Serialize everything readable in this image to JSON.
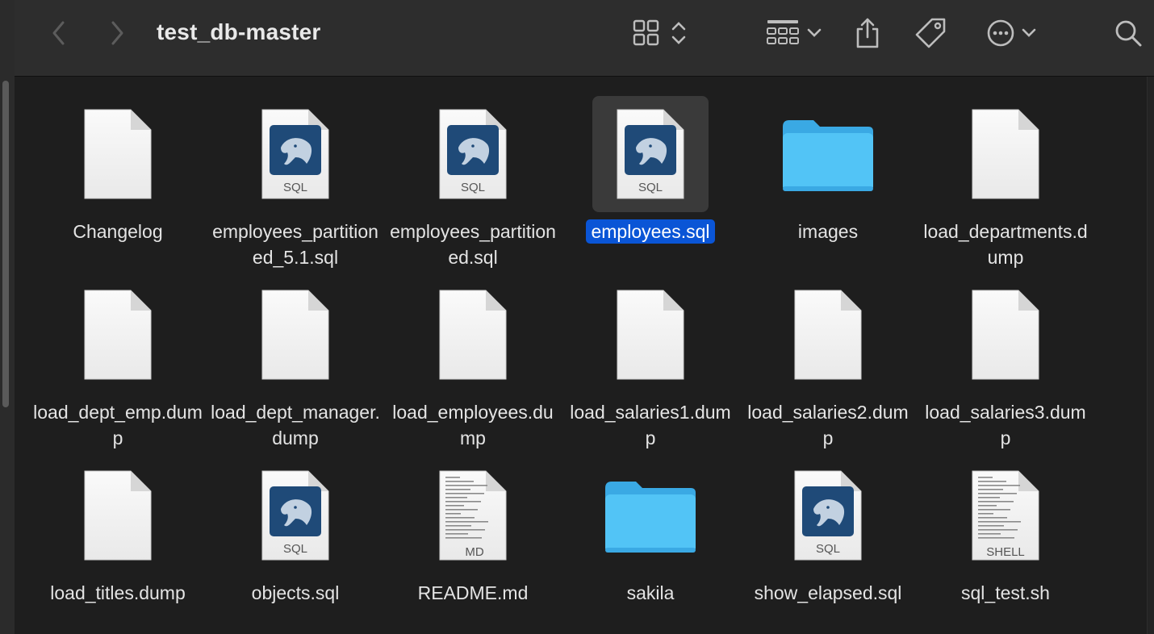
{
  "window": {
    "title": "test_db-master"
  },
  "toolbar": {
    "back_icon": "chevron-left-icon",
    "forward_icon": "chevron-right-icon",
    "view_icon": "icon-grid-icon",
    "group_icon": "group-by-icon",
    "share_icon": "share-icon",
    "tag_icon": "tag-icon",
    "more_icon": "ellipsis-circle-icon",
    "search_icon": "search-icon"
  },
  "files": [
    {
      "name": "Changelog",
      "kind": "doc"
    },
    {
      "name": "employees_partitioned_5.1.sql",
      "kind": "sql"
    },
    {
      "name": "employees_partitioned.sql",
      "kind": "sql"
    },
    {
      "name": "employees.sql",
      "kind": "sql",
      "selected": true
    },
    {
      "name": "images",
      "kind": "folder"
    },
    {
      "name": "load_departments.dump",
      "kind": "doc"
    },
    {
      "name": "load_dept_emp.dump",
      "kind": "doc"
    },
    {
      "name": "load_dept_manager.dump",
      "kind": "doc"
    },
    {
      "name": "load_employees.dump",
      "kind": "doc"
    },
    {
      "name": "load_salaries1.dump",
      "kind": "doc"
    },
    {
      "name": "load_salaries2.dump",
      "kind": "doc"
    },
    {
      "name": "load_salaries3.dump",
      "kind": "doc"
    },
    {
      "name": "load_titles.dump",
      "kind": "doc"
    },
    {
      "name": "objects.sql",
      "kind": "sql"
    },
    {
      "name": "README.md",
      "kind": "md"
    },
    {
      "name": "sakila",
      "kind": "folder"
    },
    {
      "name": "show_elapsed.sql",
      "kind": "sql"
    },
    {
      "name": "sql_test.sh",
      "kind": "shell"
    }
  ],
  "badges": {
    "sql": "SQL",
    "md": "MD",
    "shell": "SHELL"
  },
  "colors": {
    "selection": "#0a55d6",
    "folder": "#4fc3f7",
    "sql_tile": "#1f4a78"
  }
}
